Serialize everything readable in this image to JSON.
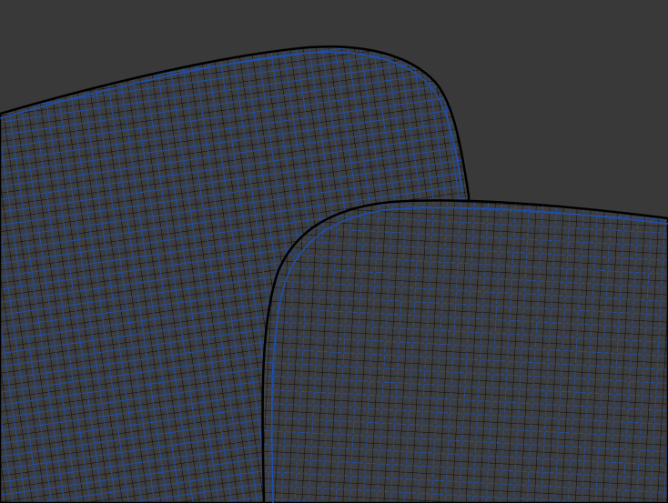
{
  "viewport": {
    "colors": {
      "background": "#393939",
      "surface": "#3d3d3d",
      "edge_lines": "#0a0a0a",
      "wire_lines": "#1d4fb0"
    },
    "icons": [
      "mesh-wireframe"
    ]
  }
}
